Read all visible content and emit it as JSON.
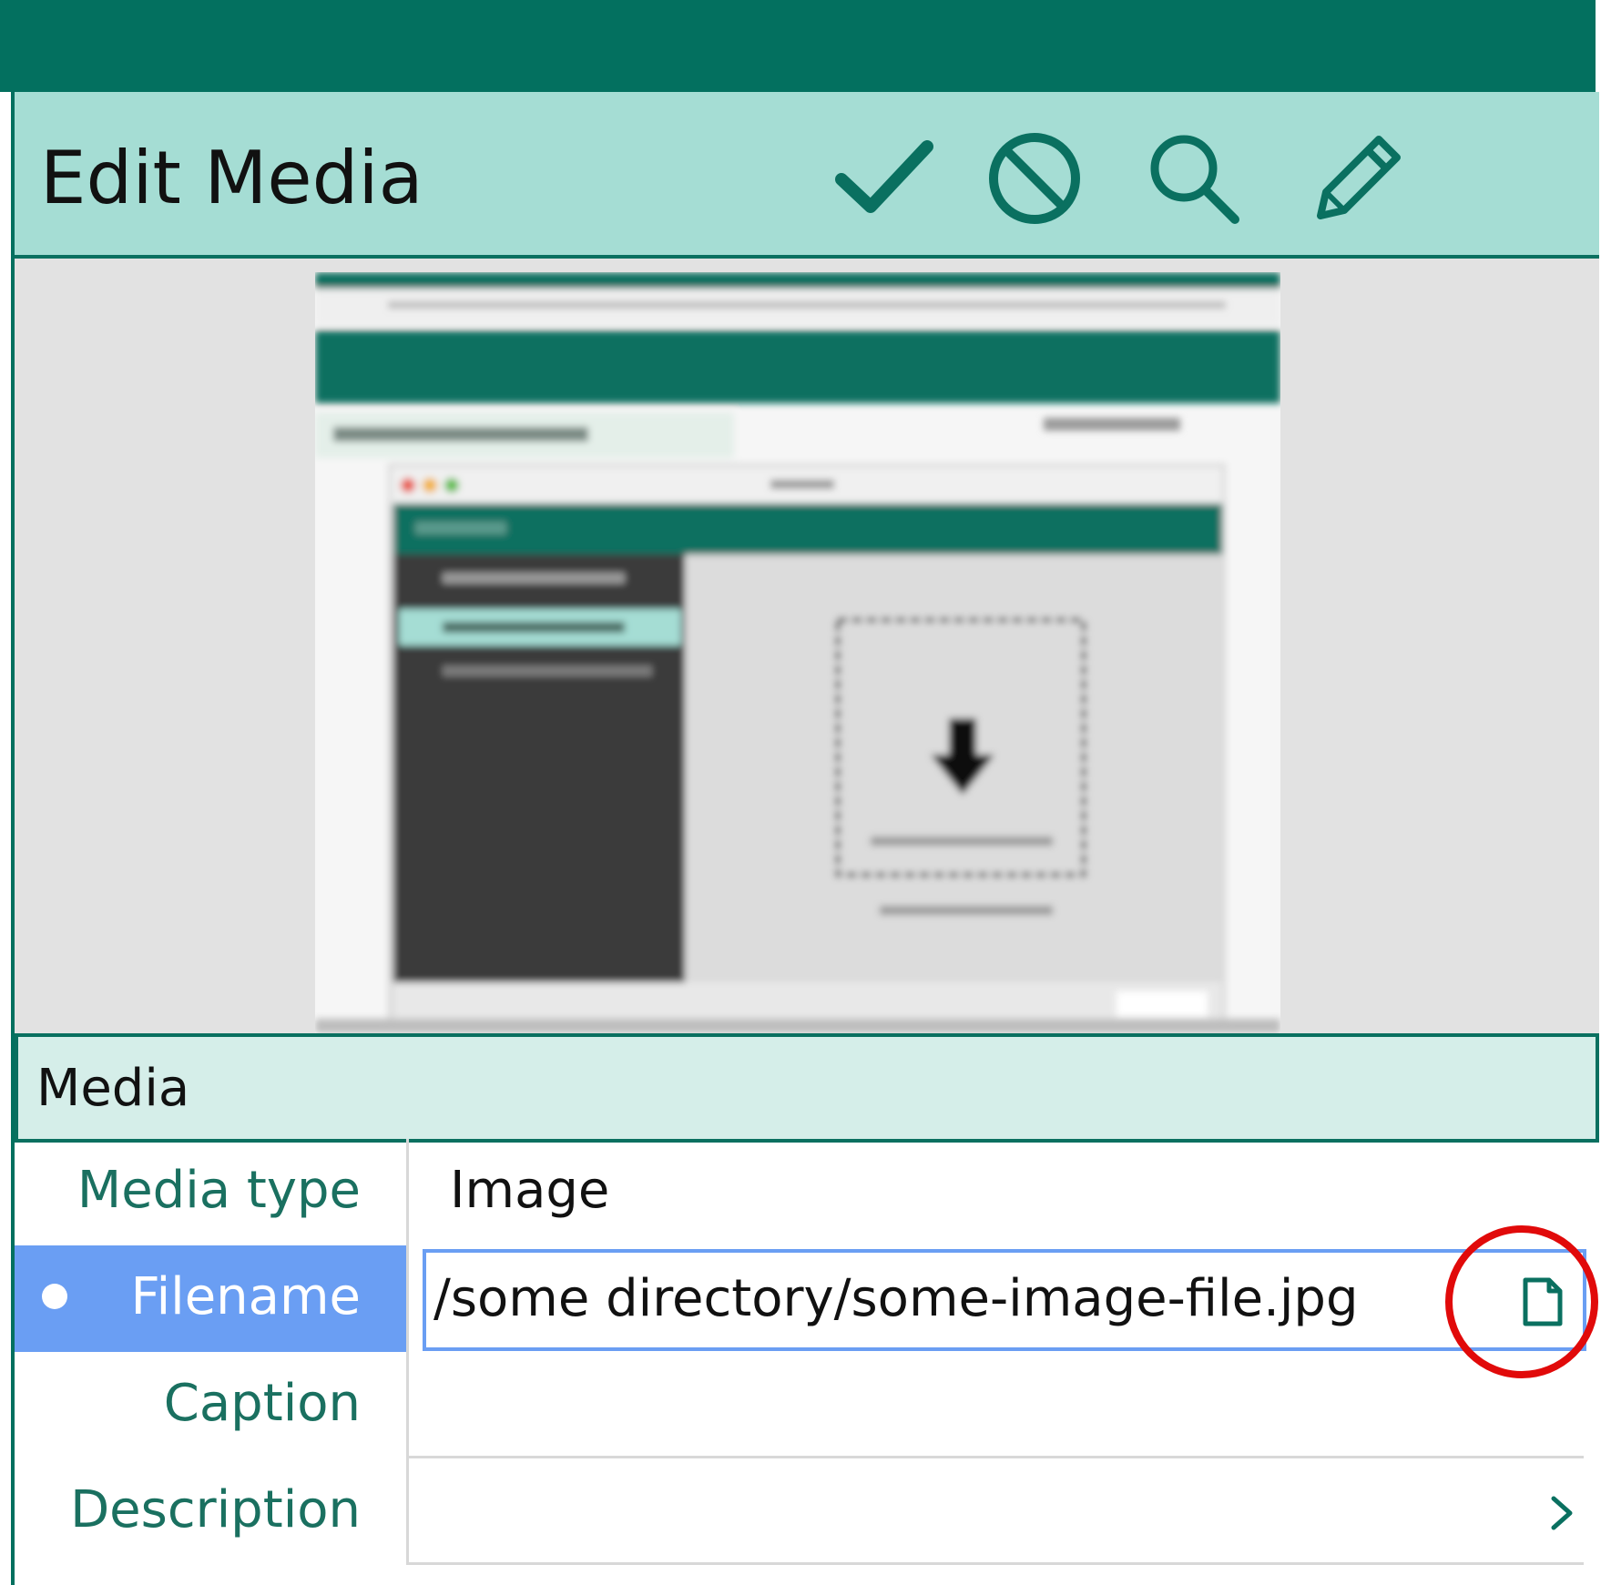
{
  "header": {
    "title": "Edit Media",
    "buttons": [
      {
        "name": "save",
        "icon": "checkmark-icon"
      },
      {
        "name": "cancel",
        "icon": "prohibit-icon"
      },
      {
        "name": "search",
        "icon": "search-icon"
      },
      {
        "name": "edit",
        "icon": "pencil-icon"
      }
    ]
  },
  "preview": {
    "icon": "image-thumbnail"
  },
  "section": {
    "title": "Media"
  },
  "fields": {
    "media_type": {
      "label": "Media type",
      "value": "Image"
    },
    "filename": {
      "label": "Filename",
      "value": "/some directory/some-image-file.jpg",
      "button_icon": "file-icon"
    },
    "caption": {
      "label": "Caption",
      "value": ""
    },
    "description": {
      "label": "Description",
      "value": "",
      "icon": "chevron-right-icon"
    }
  },
  "colors": {
    "topbar": "#03705f",
    "header_bg": "#a5ddd4",
    "section_bg": "#d5eee9",
    "label_text": "#1a7060",
    "selected_row": "#6a9ef3",
    "highlight": "#e10a0a"
  }
}
